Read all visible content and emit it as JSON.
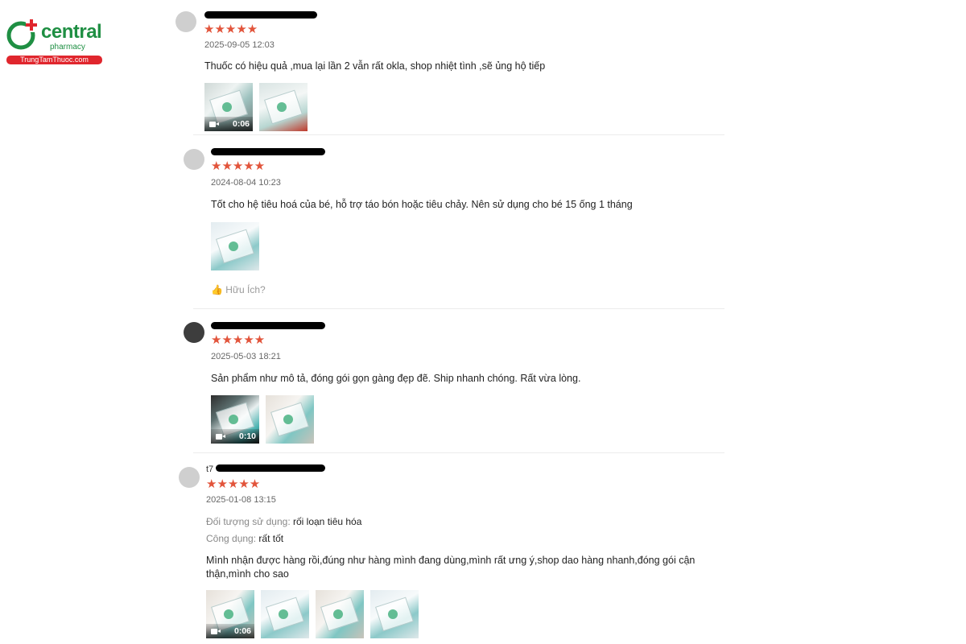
{
  "brand": {
    "name": "central",
    "sub": "pharmacy",
    "tag": "TrungTamThuoc.com",
    "color": "#1f8f43",
    "accent": "#e0262d"
  },
  "star_color": "#e2543b",
  "reviews": [
    {
      "username": "",
      "stars": "★★★★★",
      "rating": 5,
      "date": "2025-09-05 12:03",
      "text": "Thuốc có hiệu quả ,mua lại lần 2 vẫn rất okla, shop nhiệt tình ,sẽ ủng hộ tiếp",
      "media": [
        {
          "type": "video",
          "duration": "0:06"
        },
        {
          "type": "image"
        }
      ]
    },
    {
      "username": "",
      "stars": "★★★★★",
      "rating": 5,
      "date": "2024-08-04 10:23",
      "text": "Tốt cho hệ tiêu hoá của bé, hỗ trợ táo bón hoặc tiêu chảy. Nên sử dụng cho bé 15 ống 1 tháng",
      "media": [
        {
          "type": "image"
        }
      ],
      "helpful": "Hữu Ích?"
    },
    {
      "username": "",
      "stars": "★★★★★",
      "rating": 5,
      "date": "2025-05-03 18:21",
      "text": "Sản phẩm như mô tả, đóng gói gọn gàng đẹp đẽ. Ship nhanh chóng. Rất vừa lòng.",
      "media": [
        {
          "type": "video",
          "duration": "0:10"
        },
        {
          "type": "image"
        }
      ]
    },
    {
      "username": "t7",
      "stars": "★★★★★",
      "rating": 5,
      "date": "2025-01-08 13:15",
      "attributes": [
        {
          "label": "Đối tượng sử dụng:",
          "value": "rối loạn tiêu hóa"
        },
        {
          "label": "Công dụng:",
          "value": "rất tốt"
        }
      ],
      "text": "Mình nhận được hàng rồi,đúng như hàng mình đang dùng,mình rất ưng ý,shop dao hàng nhanh,đóng gói cận thận,mình cho sao",
      "media": [
        {
          "type": "video",
          "duration": "0:06"
        },
        {
          "type": "image"
        },
        {
          "type": "image"
        },
        {
          "type": "image"
        }
      ]
    }
  ]
}
